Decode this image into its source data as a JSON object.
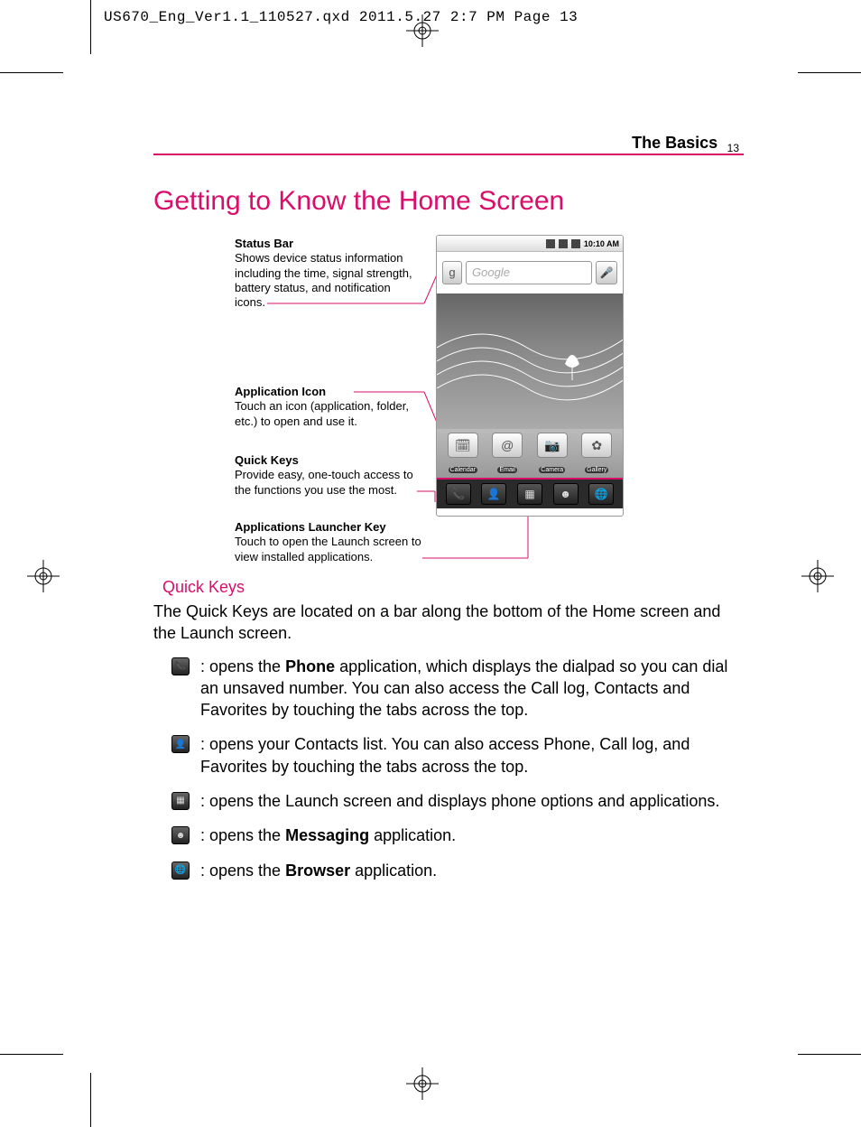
{
  "print_header": "US670_Eng_Ver1.1_110527.qxd  2011.5.27  2:7 PM  Page 13",
  "running_head": {
    "section": "The Basics",
    "page": "13"
  },
  "title": "Getting to Know the Home Screen",
  "annotations": {
    "status_bar": {
      "label": "Status Bar",
      "desc": "Shows device status information including the time, signal strength, battery status, and notification icons."
    },
    "app_icon": {
      "label": "Application Icon",
      "desc": "Touch an icon (application, folder, etc.) to open and use it."
    },
    "quick_keys": {
      "label": "Quick Keys",
      "desc": "Provide easy, one-touch access to the functions you use the most."
    },
    "launcher": {
      "label": "Applications Launcher Key",
      "desc": "Touch to open the Launch screen to view installed applications."
    }
  },
  "phone": {
    "time": "10:10 AM",
    "search_placeholder": "Google",
    "apps": [
      {
        "label": "Calendar"
      },
      {
        "label": "Email"
      },
      {
        "label": "Camera"
      },
      {
        "label": "Gallery"
      }
    ]
  },
  "quick_keys_section": {
    "heading": "Quick Keys",
    "intro": "The Quick Keys are located on a bar along the bottom of the Home screen and the Launch screen.",
    "items": {
      "phone": {
        "pre": ": opens the ",
        "bold": "Phone",
        "post": " application, which displays the dialpad so you can dial an unsaved number. You can also access the Call log, Contacts and Favorites by touching the tabs across the top."
      },
      "contacts": {
        "text": ": opens your Contacts list. You can also access Phone, Call log, and Favorites by touching the tabs across the top."
      },
      "launch": {
        "text": ": opens the Launch screen and displays phone options and applications."
      },
      "messaging": {
        "pre": ": opens the ",
        "bold": "Messaging",
        "post": " application."
      },
      "browser": {
        "pre": ": opens the ",
        "bold": "Browser",
        "post": " application."
      }
    }
  }
}
